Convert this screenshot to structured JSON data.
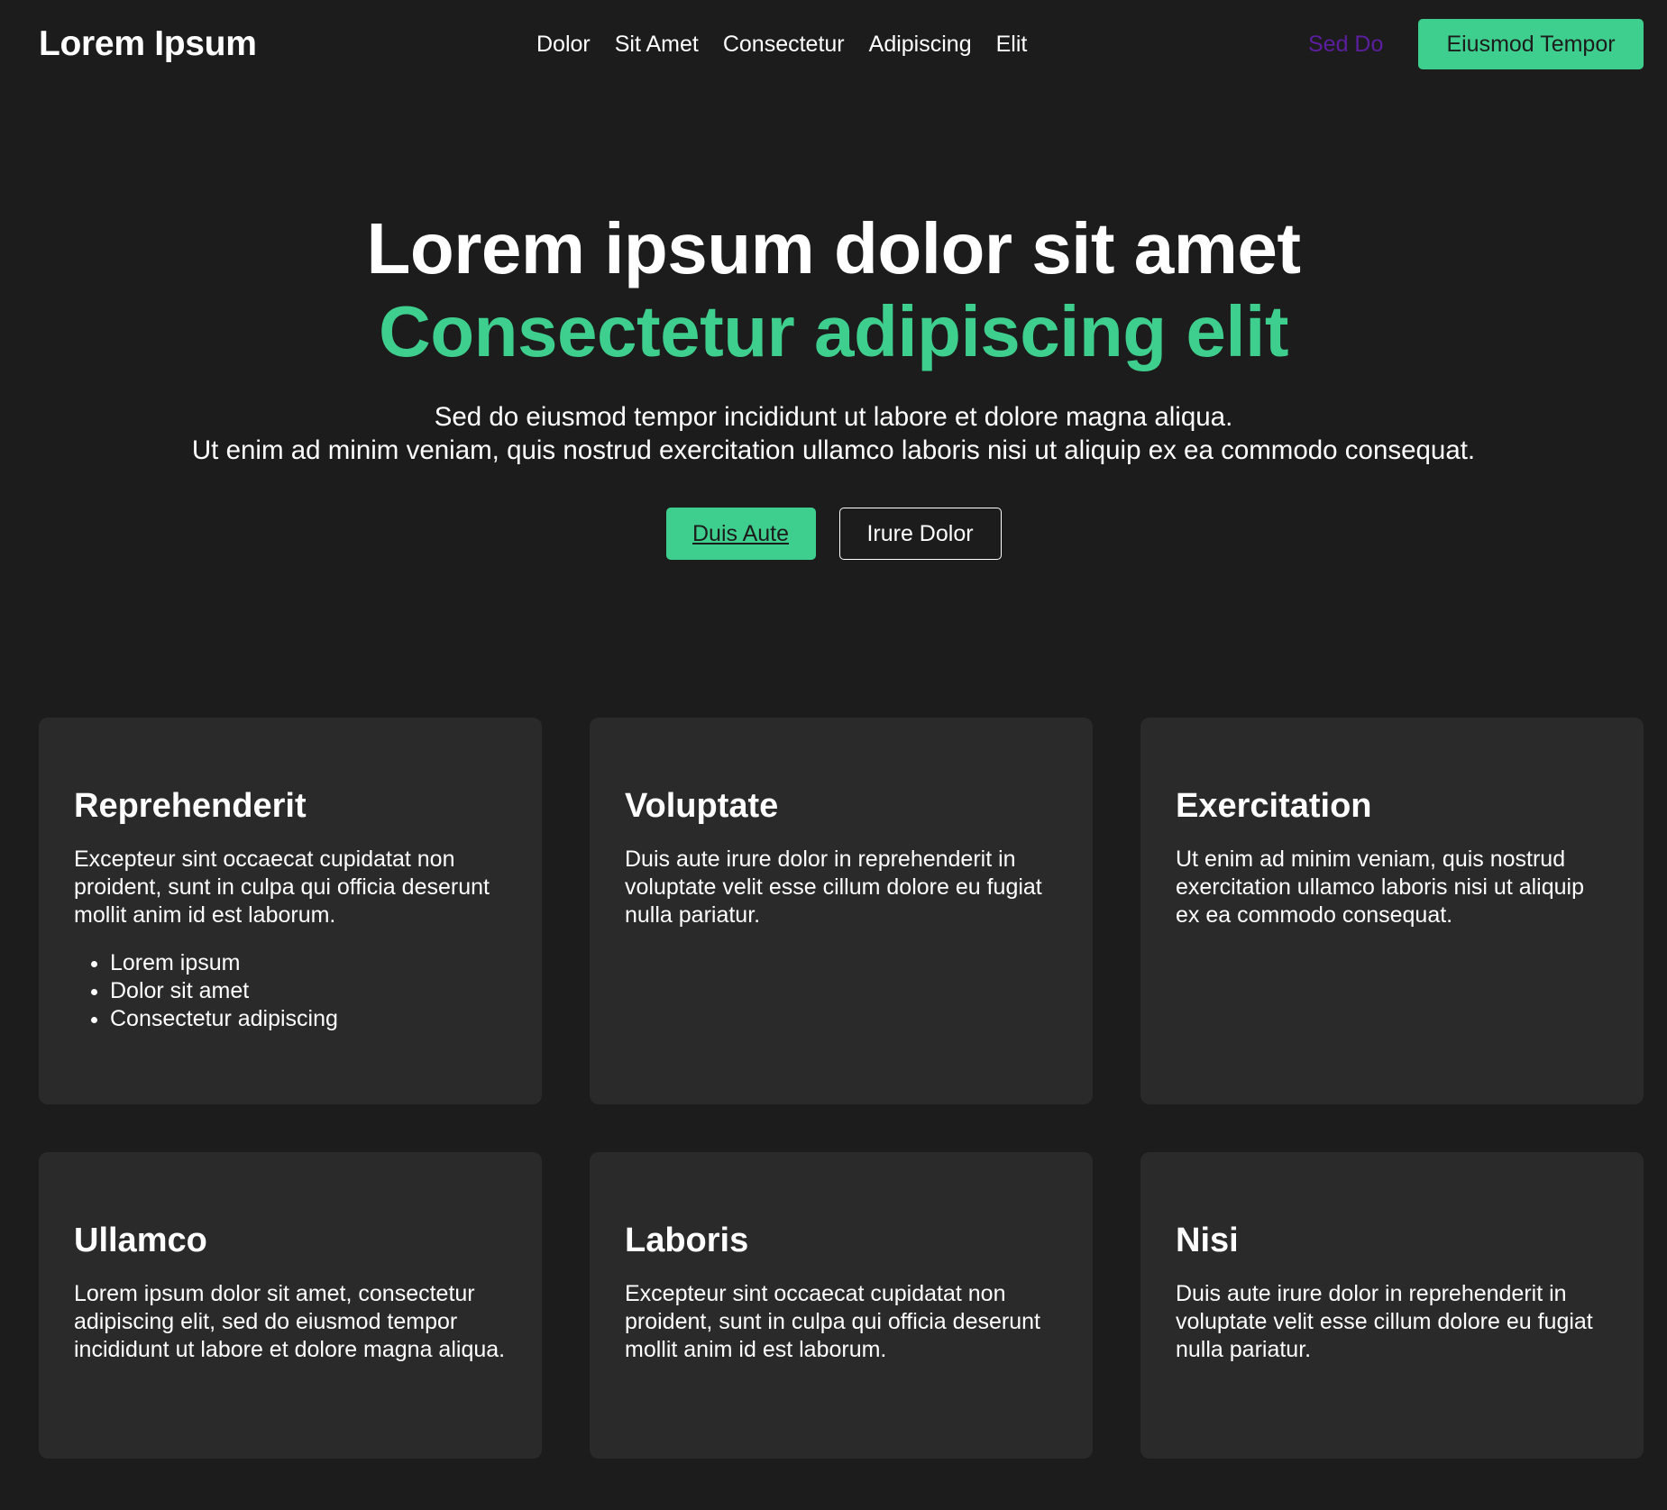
{
  "colors": {
    "background": "#1c1c1c",
    "card": "#2a2a2a",
    "accent": "#3ecf8e",
    "link_visited": "#5b1e9e",
    "text": "#ffffff"
  },
  "header": {
    "logo": "Lorem Ipsum",
    "nav": [
      "Dolor",
      "Sit Amet",
      "Consectetur",
      "Adipiscing",
      "Elit"
    ],
    "secondary_link": "Sed Do",
    "cta": "Eiusmod Tempor"
  },
  "hero": {
    "title_line1": "Lorem ipsum dolor sit amet",
    "title_line2": "Consectetur adipiscing elit",
    "subtitle_line1": "Sed do eiusmod tempor incididunt ut labore et dolore magna aliqua.",
    "subtitle_line2": "Ut enim ad minim veniam, quis nostrud exercitation ullamco laboris nisi ut aliquip ex ea commodo consequat.",
    "primary_button": "Duis Aute",
    "secondary_button": "Irure Dolor"
  },
  "cards": [
    {
      "title": "Reprehenderit",
      "body": "Excepteur sint occaecat cupidatat non proident, sunt in culpa qui officia deserunt mollit anim id est laborum.",
      "list": [
        "Lorem ipsum",
        "Dolor sit amet",
        "Consectetur adipiscing"
      ]
    },
    {
      "title": "Voluptate",
      "body": "Duis aute irure dolor in reprehenderit in voluptate velit esse cillum dolore eu fugiat nulla pariatur."
    },
    {
      "title": "Exercitation",
      "body": "Ut enim ad minim veniam, quis nostrud exercitation ullamco laboris nisi ut aliquip ex ea commodo consequat."
    },
    {
      "title": "Ullamco",
      "body": "Lorem ipsum dolor sit amet, consectetur adipiscing elit, sed do eiusmod tempor incididunt ut labore et dolore magna aliqua."
    },
    {
      "title": "Laboris",
      "body": "Excepteur sint occaecat cupidatat non proident, sunt in culpa qui officia deserunt mollit anim id est laborum."
    },
    {
      "title": "Nisi",
      "body": "Duis aute irure dolor in reprehenderit in voluptate velit esse cillum dolore eu fugiat nulla pariatur."
    }
  ]
}
